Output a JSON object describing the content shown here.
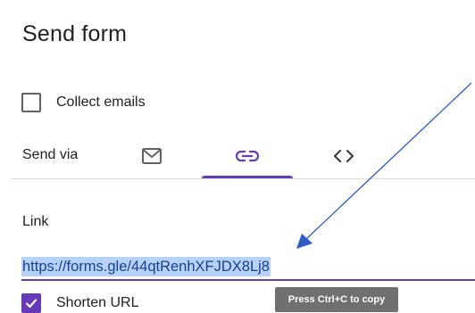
{
  "dialog": {
    "title": "Send form"
  },
  "collect_emails": {
    "label": "Collect emails",
    "checked": false
  },
  "send_via": {
    "label": "Send via",
    "tabs": [
      {
        "name": "email",
        "icon": "envelope-icon",
        "selected": false
      },
      {
        "name": "link",
        "icon": "link-icon",
        "selected": true
      },
      {
        "name": "embed",
        "icon": "code-brackets-icon",
        "selected": false
      }
    ],
    "accent_color": "#673ab7"
  },
  "link_section": {
    "label": "Link",
    "url": "https://forms.gle/44qtRenhXFJDX8Lj8",
    "selected": true
  },
  "tooltip": {
    "text": "Press Ctrl+C to copy"
  },
  "shorten_url": {
    "label": "Shorten URL",
    "checked": true
  },
  "annotation": {
    "arrow_color": "#2f5bc9"
  }
}
